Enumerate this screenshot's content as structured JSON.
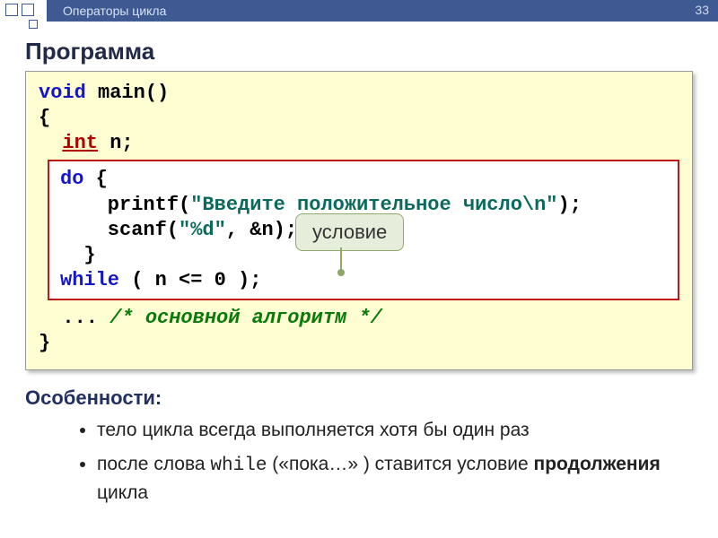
{
  "header": {
    "title": "Операторы цикла",
    "page_num": "33"
  },
  "section_title": "Программа",
  "code": {
    "line1_kw": "void",
    "line1_rest": " main()",
    "line2": "{",
    "line3_kw": "int",
    "line3_rest": " n;",
    "inner": {
      "l1_do": "do",
      "l1_brace": " {",
      "l2_pre": "    printf(",
      "l2_str": "\"Введите положительное число\\n\"",
      "l2_post": ");",
      "l3_pre": "    scanf(",
      "l3_str": "\"%d\"",
      "l3_post": ", &n);",
      "l4": "  }",
      "l5_while": "while",
      "l5_cond_pre": " ( ",
      "l5_cond": "n <= 0",
      "l5_cond_post": " );"
    },
    "line_dots": "  ... ",
    "line_comment": "/* основной алгоритм */",
    "line_close": "}"
  },
  "callout": {
    "label": "условие"
  },
  "features": {
    "title": "Особенности:",
    "items": [
      {
        "text_pre": "тело цикла всегда выполняется хотя бы один раз",
        "mono": "",
        "text_mid": "",
        "bold": "",
        "text_post": ""
      },
      {
        "text_pre": "после слова ",
        "mono": "while",
        "text_mid": " («пока…» ) ставится условие ",
        "bold": "продолжения",
        "text_post": " цикла"
      }
    ]
  }
}
